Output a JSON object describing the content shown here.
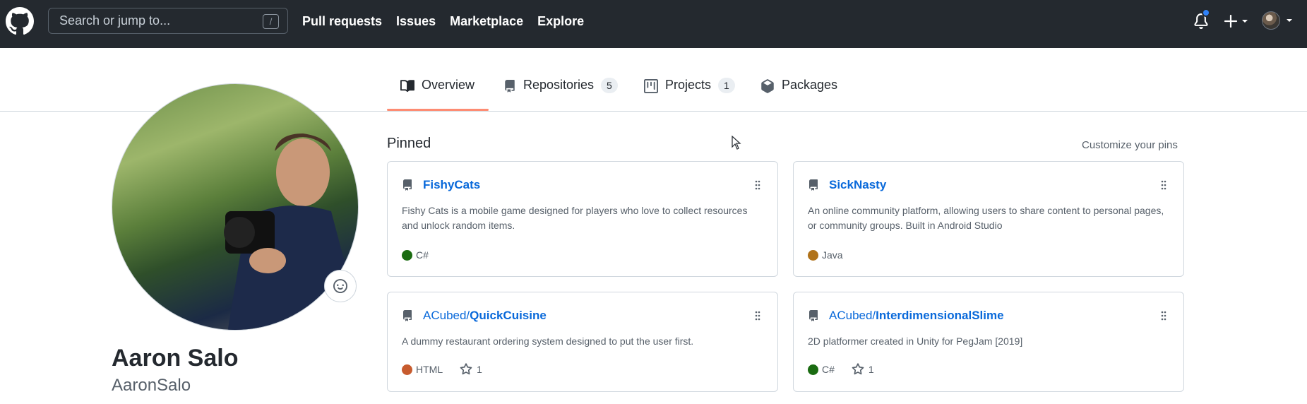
{
  "header": {
    "search": {
      "placeholder": "Search or jump to...",
      "shortcut": "/"
    },
    "nav": [
      "Pull requests",
      "Issues",
      "Marketplace",
      "Explore"
    ]
  },
  "tabs": [
    {
      "label": "Overview",
      "icon": "book-icon",
      "selected": true
    },
    {
      "label": "Repositories",
      "icon": "repo-icon",
      "count": "5"
    },
    {
      "label": "Projects",
      "icon": "project-icon",
      "count": "1"
    },
    {
      "label": "Packages",
      "icon": "package-icon"
    }
  ],
  "profile": {
    "name": "Aaron Salo",
    "username": "AaronSalo"
  },
  "pinned": {
    "title": "Pinned",
    "customize_label": "Customize your pins",
    "cards": [
      {
        "owner": "",
        "name": "FishyCats",
        "description": "Fishy Cats is a mobile game designed for players who love to collect resources and unlock random items.",
        "language": "C#",
        "language_color": "#178600",
        "stars": ""
      },
      {
        "owner": "",
        "name": "SickNasty",
        "description": "An online community platform, allowing users to share content to personal pages, or community groups. Built in Android Studio",
        "language": "Java",
        "language_color": "#b07219",
        "stars": ""
      },
      {
        "owner": "ACubed/",
        "name": "QuickCuisine",
        "description": "A dummy restaurant ordering system designed to put the user first.",
        "language": "HTML",
        "language_color": "#e34c26",
        "stars": "1"
      },
      {
        "owner": "ACubed/",
        "name": "InterdimensionalSlime",
        "description": "2D platformer created in Unity for PegJam [2019]",
        "language": "C#",
        "language_color": "#178600",
        "stars": "1"
      }
    ]
  },
  "colors": {
    "header_bg": "#24292f",
    "link": "#0969da",
    "tab_underline": "#fd8c73",
    "notification_dot": "#2f81f7"
  }
}
